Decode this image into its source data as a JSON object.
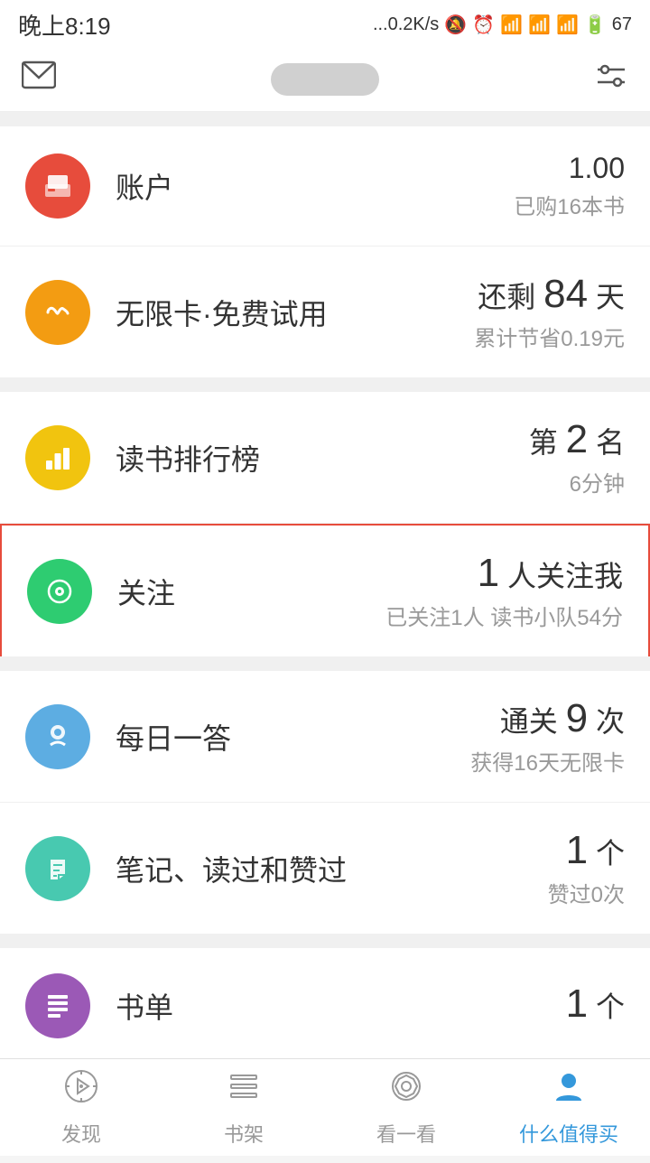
{
  "statusBar": {
    "time": "晚上8:19",
    "network": "...0.2K/s",
    "battery": "67"
  },
  "navBar": {
    "settingsIcon": "⚙",
    "mailIcon": "✉"
  },
  "menuSections": [
    {
      "id": "section1",
      "items": [
        {
          "id": "account",
          "iconBg": "icon-red",
          "iconType": "account",
          "label": "账户",
          "rightMain": "1.00",
          "rightSub": "已购16本书"
        },
        {
          "id": "unlimited",
          "iconBg": "icon-orange",
          "iconType": "unlimited",
          "label": "无限卡·免费试用",
          "rightMain": "还剩 84 天",
          "rightSub": "累计节省0.19元"
        }
      ]
    },
    {
      "id": "section2",
      "items": [
        {
          "id": "ranking",
          "iconBg": "icon-yellow",
          "iconType": "ranking",
          "label": "读书排行榜",
          "rightMain": "第 2 名",
          "rightSub": "6分钟"
        },
        {
          "id": "follow",
          "iconBg": "icon-green",
          "iconType": "follow",
          "label": "关注",
          "rightMain": "1 人关注我",
          "rightSub": "已关注1人 读书小队54分",
          "highlighted": true
        }
      ]
    },
    {
      "id": "section3",
      "items": [
        {
          "id": "daily",
          "iconBg": "icon-light-blue",
          "iconType": "daily",
          "label": "每日一答",
          "rightMain": "通关 9 次",
          "rightSub": "获得16天无限卡"
        },
        {
          "id": "notes",
          "iconBg": "icon-teal",
          "iconType": "notes",
          "label": "笔记、读过和赞过",
          "rightMain": "1 个",
          "rightSub": "赞过0次"
        }
      ]
    },
    {
      "id": "section4",
      "items": [
        {
          "id": "booklist",
          "iconBg": "icon-purple",
          "iconType": "booklist",
          "label": "书单",
          "rightMain": "1 个",
          "rightSub": ""
        }
      ]
    }
  ],
  "tabBar": {
    "tabs": [
      {
        "id": "discover",
        "label": "发现",
        "icon": "compass",
        "active": false
      },
      {
        "id": "bookshelf",
        "label": "书架",
        "icon": "bookshelf",
        "active": false
      },
      {
        "id": "browse",
        "label": "看一看",
        "icon": "browse",
        "active": false
      },
      {
        "id": "profile",
        "label": "什么值得买",
        "icon": "person",
        "active": true
      }
    ]
  }
}
